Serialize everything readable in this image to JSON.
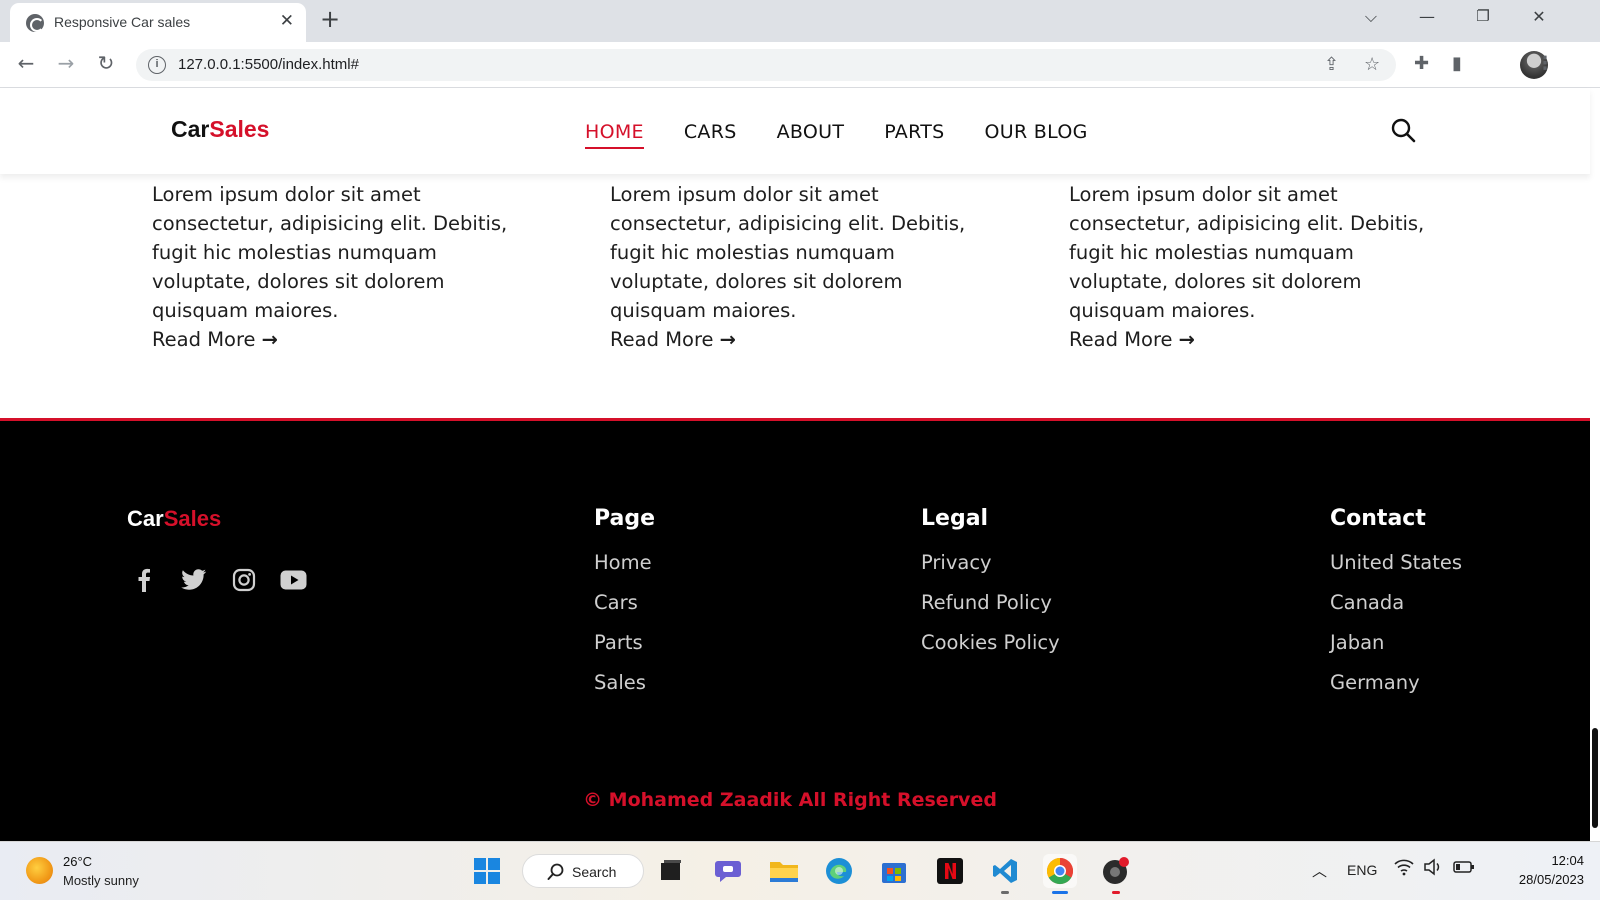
{
  "browser": {
    "tab_title": "Responsive Car sales",
    "url": "127.0.0.1:5500/index.html#"
  },
  "site": {
    "logo": {
      "part1": "Car",
      "part2": "Sales"
    },
    "nav": [
      {
        "label": "HOME",
        "active": true
      },
      {
        "label": "CARS",
        "active": false
      },
      {
        "label": "ABOUT",
        "active": false
      },
      {
        "label": "PARTS",
        "active": false
      },
      {
        "label": "OUR BLOG",
        "active": false
      }
    ],
    "accent_color": "#d5102a",
    "blog_cards": [
      {
        "text": "Lorem ipsum dolor sit amet consectetur, adipisicing elit. Debitis, fugit hic molestias numquam voluptate, dolores sit dolorem quisquam maiores.",
        "read_more": "Read More"
      },
      {
        "text": "Lorem ipsum dolor sit amet consectetur, adipisicing elit. Debitis, fugit hic molestias numquam voluptate, dolores sit dolorem quisquam maiores.",
        "read_more": "Read More"
      },
      {
        "text": "Lorem ipsum dolor sit amet consectetur, adipisicing elit. Debitis, fugit hic molestias numquam voluptate, dolores sit dolorem quisquam maiores.",
        "read_more": "Read More"
      }
    ],
    "footer": {
      "logo": {
        "part1": "Car",
        "part2": "Sales"
      },
      "social_icons": [
        "facebook-icon",
        "twitter-icon",
        "instagram-icon",
        "youtube-icon"
      ],
      "columns": [
        {
          "title": "Page",
          "links": [
            "Home",
            "Cars",
            "Parts",
            "Sales"
          ]
        },
        {
          "title": "Legal",
          "links": [
            "Privacy",
            "Refund Policy",
            "Cookies Policy"
          ]
        },
        {
          "title": "Contact",
          "links": [
            "United States",
            "Canada",
            "Jaban",
            "Germany"
          ]
        }
      ],
      "copyright": "© Mohamed Zaadik All Right Reserved"
    }
  },
  "taskbar": {
    "weather": {
      "temp": "26°C",
      "desc": "Mostly sunny"
    },
    "search_label": "Search",
    "language": "ENG",
    "time": "12:04",
    "date": "28/05/2023"
  }
}
